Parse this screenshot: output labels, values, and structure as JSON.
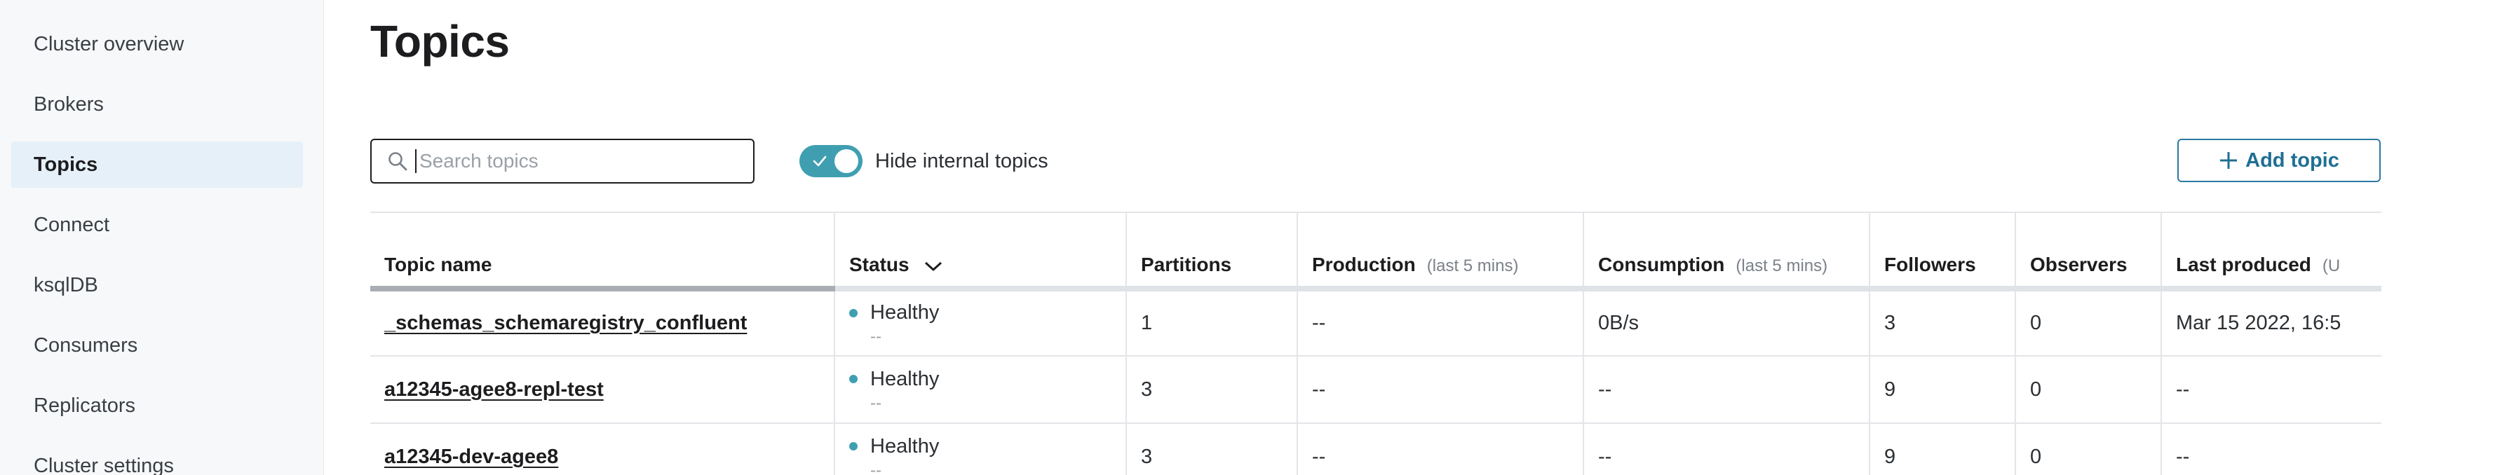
{
  "sidebar": {
    "items": [
      {
        "label": "Cluster overview",
        "active": false
      },
      {
        "label": "Brokers",
        "active": false
      },
      {
        "label": "Topics",
        "active": true
      },
      {
        "label": "Connect",
        "active": false
      },
      {
        "label": "ksqlDB",
        "active": false
      },
      {
        "label": "Consumers",
        "active": false
      },
      {
        "label": "Replicators",
        "active": false
      },
      {
        "label": "Cluster settings",
        "active": false
      }
    ]
  },
  "main": {
    "title": "Topics",
    "search_placeholder": "Search topics",
    "toggle_label": "Hide internal topics",
    "toggle_on": true,
    "add_topic_label": "Add topic"
  },
  "table": {
    "columns": [
      {
        "label": "Topic name",
        "sub": ""
      },
      {
        "label": "Status",
        "sub": ""
      },
      {
        "label": "Partitions",
        "sub": ""
      },
      {
        "label": "Production",
        "sub": "(last 5 mins)"
      },
      {
        "label": "Consumption",
        "sub": "(last 5 mins)"
      },
      {
        "label": "Followers",
        "sub": ""
      },
      {
        "label": "Observers",
        "sub": ""
      },
      {
        "label": "Last produced",
        "sub": "(U"
      }
    ],
    "rows": [
      {
        "name": "_schemas_schemaregistry_confluent",
        "status": "Healthy",
        "status_sub": "--",
        "partitions": "1",
        "production": "--",
        "consumption": "0B/s",
        "followers": "3",
        "observers": "0",
        "last_produced": "Mar 15 2022, 16:5"
      },
      {
        "name": "a12345-agee8-repl-test",
        "status": "Healthy",
        "status_sub": "--",
        "partitions": "3",
        "production": "--",
        "consumption": "--",
        "followers": "9",
        "observers": "0",
        "last_produced": "--"
      },
      {
        "name": "a12345-dev-agee8",
        "status": "Healthy",
        "status_sub": "--",
        "partitions": "3",
        "production": "--",
        "consumption": "--",
        "followers": "9",
        "observers": "0",
        "last_produced": "--"
      }
    ]
  },
  "colors": {
    "accent": "#3f9fb1",
    "button_text": "#1f6f93",
    "active_nav_bg": "#e6f0f9"
  }
}
